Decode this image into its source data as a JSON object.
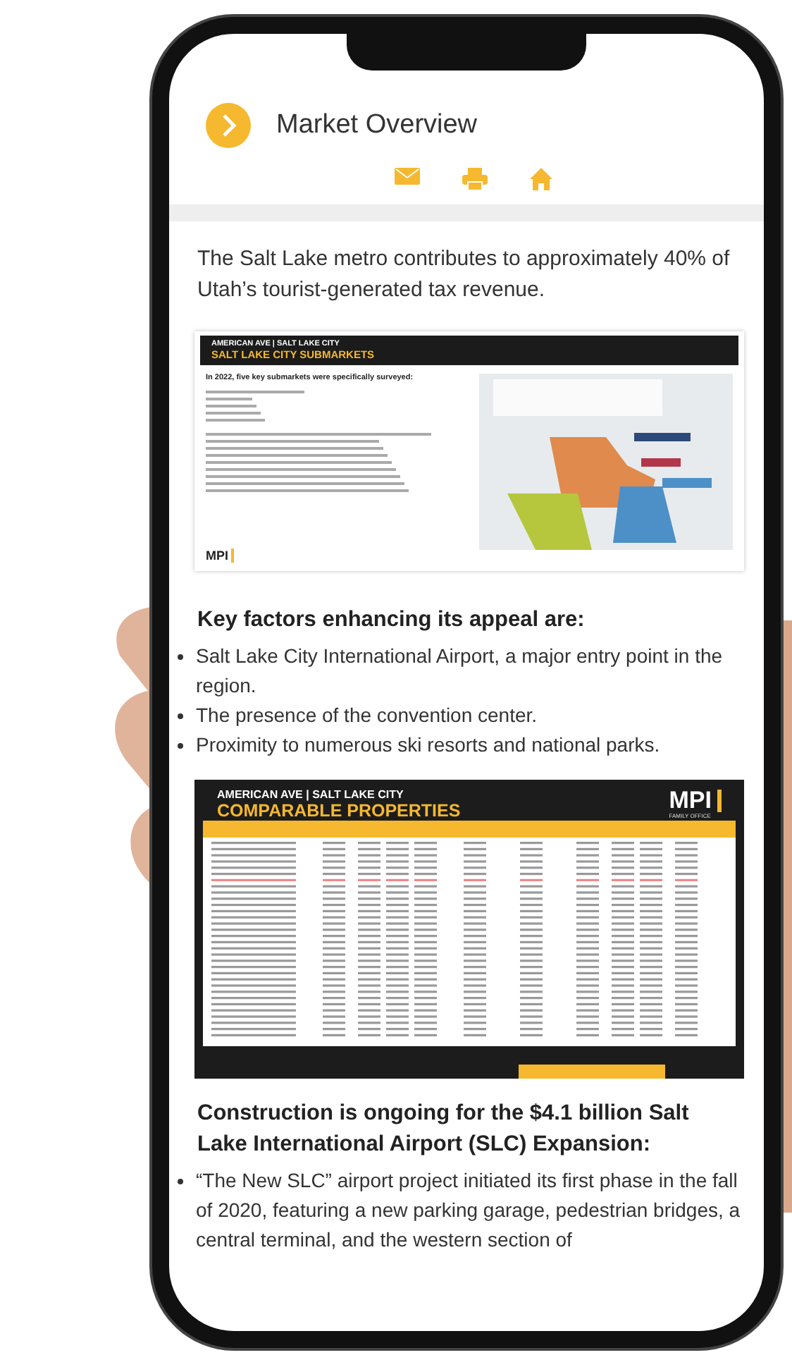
{
  "header": {
    "title": "Market Overview"
  },
  "toolbar": [
    {
      "kind": "mail"
    },
    {
      "kind": "print"
    },
    {
      "kind": "home"
    }
  ],
  "intro": "The Salt Lake metro contributes to approximately 40% of Utah’s tourist-generated tax revenue.",
  "slide_submarkets": {
    "subtitle": "AMERICAN AVE | SALT LAKE CITY",
    "title": "SALT LAKE CITY SUBMARKETS",
    "lead": "In 2022, five key submarkets were specifically surveyed:",
    "logo": "MPI"
  },
  "key_factors": {
    "heading": "Key factors enhancing its appeal are:",
    "bullets": [
      "Salt Lake City International Airport, a major entry point in the region.",
      "The presence of the convention center.",
      "Proximity to numerous ski resorts and national parks."
    ]
  },
  "slide_comparables": {
    "subtitle": "AMERICAN AVE | SALT LAKE CITY",
    "title": "COMPARABLE PROPERTIES",
    "logo": "MPI",
    "logo_caption": "FAMILY OFFICE"
  },
  "construction": {
    "heading": "Construction is ongoing for the $4.1 billion Salt Lake International Airport (SLC) Expansion:",
    "bullets": [
      "“The New SLC” airport project initiated its first phase in the fall of 2020, featuring a new parking garage, pedestrian bridges, a central terminal, and the western section of"
    ]
  }
}
